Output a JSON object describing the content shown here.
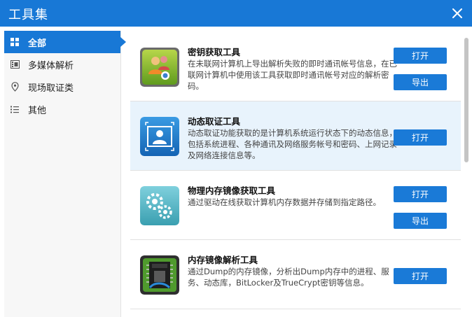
{
  "window": {
    "title": "工具集",
    "close_icon": "close-icon"
  },
  "sidebar": {
    "items": [
      {
        "label": "全部",
        "icon": "grid-icon",
        "active": true
      },
      {
        "label": "多媒体解析",
        "icon": "film-icon",
        "active": false
      },
      {
        "label": "现场取证类",
        "icon": "location-pin-icon",
        "active": false
      },
      {
        "label": "其他",
        "icon": "list-icon",
        "active": false
      }
    ]
  },
  "tools": [
    {
      "name": "密钥获取工具",
      "desc": "在未联网计算机上导出解析失败的即时通讯帐号信息，在已联网计算机中使用该工具获取即时通讯帐号对应的解析密码。",
      "icon": "key-users-icon",
      "buttons": [
        "打开",
        "导出"
      ]
    },
    {
      "name": "动态取证工具",
      "desc": "动态取证功能获取的是计算机系统运行状态下的动态信息，包括系统进程、各种通讯及网络服务帐号和密码、上网记录及网络连接信息等。",
      "icon": "profile-card-icon",
      "buttons": [
        "打开"
      ]
    },
    {
      "name": "物理内存镜像获取工具",
      "desc": "通过驱动在线获取计算机内存数据并存储到指定路径。",
      "icon": "gears-icon",
      "buttons": [
        "打开",
        "导出"
      ]
    },
    {
      "name": "内存镜像解析工具",
      "desc": "通过Dump的内存镜像，分析出Dump内存中的进程、服务、动态库，BitLocker及TrueCrypt密钥等信息。",
      "icon": "ram-chip-icon",
      "buttons": [
        "打开"
      ]
    }
  ],
  "colors": {
    "accent": "#1878d6",
    "highlight": "#e8f3fc",
    "button": "#1a7ad7"
  }
}
